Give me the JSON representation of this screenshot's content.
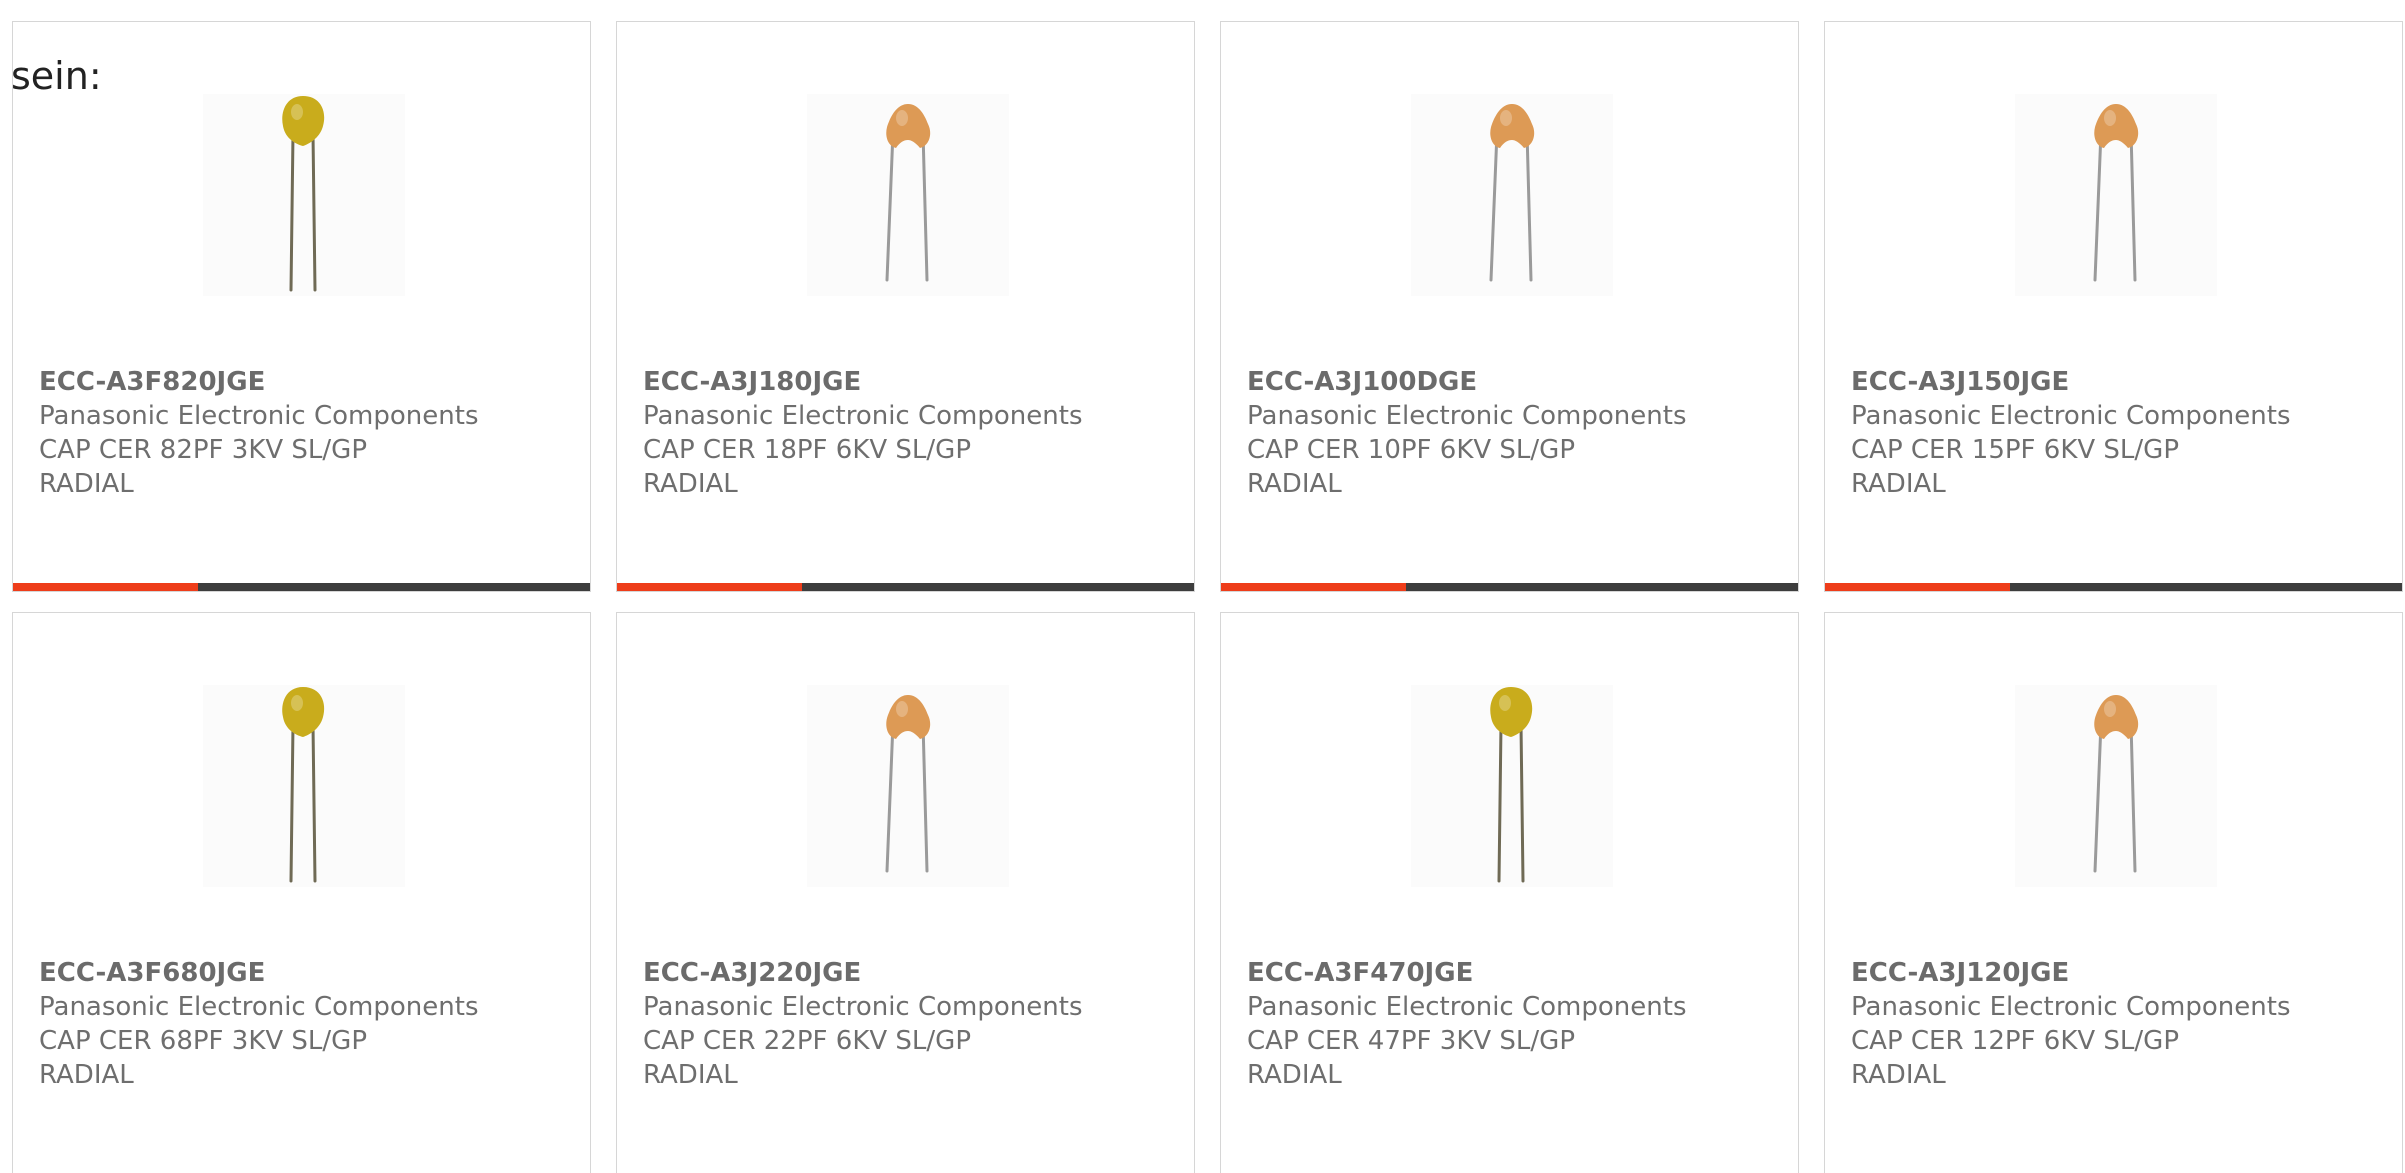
{
  "intro_text": "sein:",
  "colors": {
    "progress_accent": "#ee3d1a",
    "progress_track": "#3d3d3d",
    "yellow_body": "#c9ac1c",
    "orange_body": "#dd9a55"
  },
  "products": [
    {
      "part_number": "ECC-A3F820JGE",
      "manufacturer": "Panasonic Electronic Components",
      "description": "CAP CER 82PF 3KV SL/GP\nRADIAL",
      "image_icon": "ceramic-capacitor-yellow",
      "progress": 0.32
    },
    {
      "part_number": "ECC-A3J180JGE",
      "manufacturer": "Panasonic Electronic Components",
      "description": "CAP CER 18PF 6KV SL/GP\nRADIAL",
      "image_icon": "ceramic-capacitor-orange",
      "progress": 0.32
    },
    {
      "part_number": "ECC-A3J100DGE",
      "manufacturer": "Panasonic Electronic Components",
      "description": "CAP CER 10PF 6KV SL/GP\nRADIAL",
      "image_icon": "ceramic-capacitor-orange",
      "progress": 0.32
    },
    {
      "part_number": "ECC-A3J150JGE",
      "manufacturer": "Panasonic Electronic Components",
      "description": "CAP CER 15PF 6KV SL/GP\nRADIAL",
      "image_icon": "ceramic-capacitor-orange",
      "progress": 0.32
    },
    {
      "part_number": "ECC-A3F680JGE",
      "manufacturer": "Panasonic Electronic Components",
      "description": "CAP CER 68PF 3KV SL/GP\nRADIAL",
      "image_icon": "ceramic-capacitor-yellow"
    },
    {
      "part_number": "ECC-A3J220JGE",
      "manufacturer": "Panasonic Electronic Components",
      "description": "CAP CER 22PF 6KV SL/GP\nRADIAL",
      "image_icon": "ceramic-capacitor-orange"
    },
    {
      "part_number": "ECC-A3F470JGE",
      "manufacturer": "Panasonic Electronic Components",
      "description": "CAP CER 47PF 3KV SL/GP\nRADIAL",
      "image_icon": "ceramic-capacitor-yellow"
    },
    {
      "part_number": "ECC-A3J120JGE",
      "manufacturer": "Panasonic Electronic Components",
      "description": "CAP CER 12PF 6KV SL/GP\nRADIAL",
      "image_icon": "ceramic-capacitor-orange"
    }
  ]
}
